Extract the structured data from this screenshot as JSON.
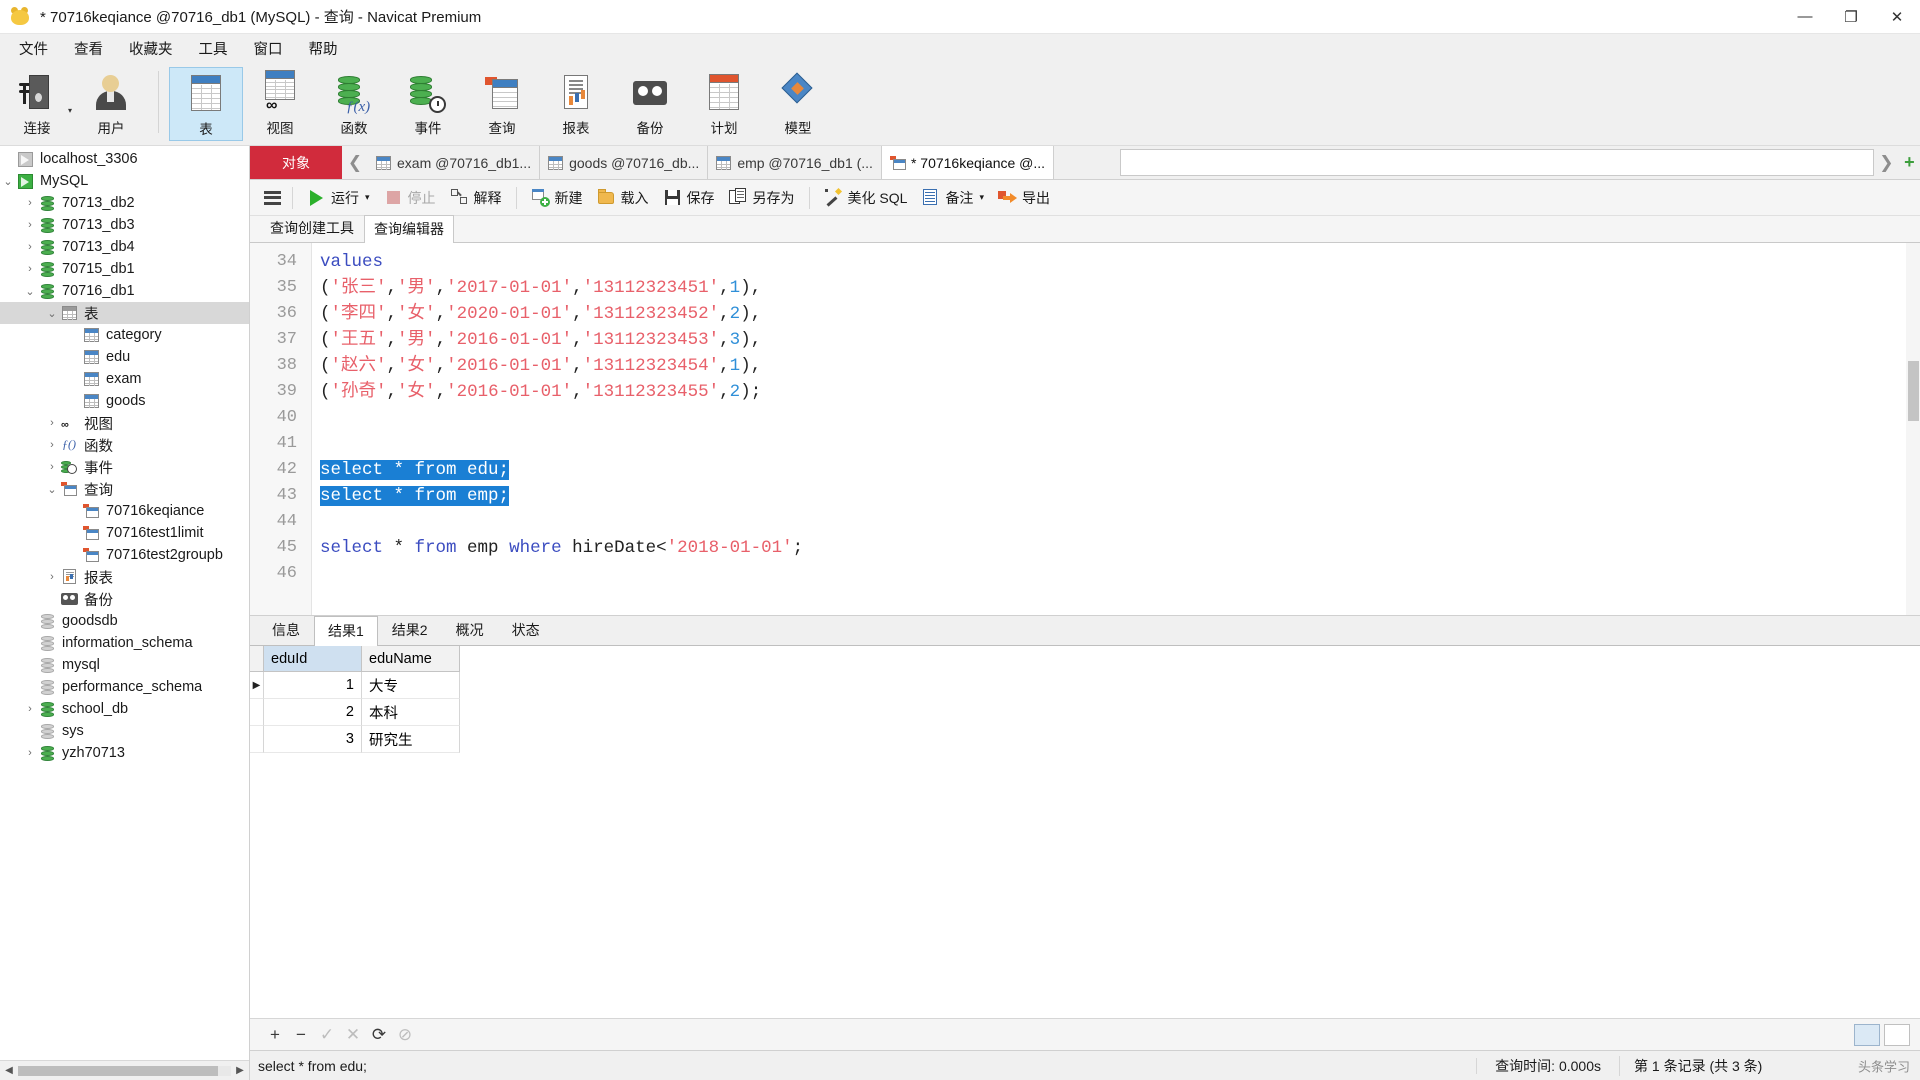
{
  "window": {
    "title": "* 70716keqiance @70716_db1 (MySQL) - 查询 - Navicat Premium",
    "minimize": "—",
    "maximize": "❐",
    "close": "✕"
  },
  "menubar": [
    "文件",
    "查看",
    "收藏夹",
    "工具",
    "窗口",
    "帮助"
  ],
  "ribbon": [
    {
      "label": "连接",
      "icon": "connection-icon",
      "caret": "▾"
    },
    {
      "label": "用户",
      "icon": "user-icon",
      "caret": ""
    },
    {
      "label": "表",
      "icon": "table-icon",
      "caret": "",
      "selected": true
    },
    {
      "label": "视图",
      "icon": "view-icon",
      "caret": ""
    },
    {
      "label": "函数",
      "icon": "function-icon",
      "caret": ""
    },
    {
      "label": "事件",
      "icon": "event-icon",
      "caret": ""
    },
    {
      "label": "查询",
      "icon": "query-icon",
      "caret": ""
    },
    {
      "label": "报表",
      "icon": "report-icon",
      "caret": ""
    },
    {
      "label": "备份",
      "icon": "backup-icon",
      "caret": ""
    },
    {
      "label": "计划",
      "icon": "schedule-icon",
      "caret": ""
    },
    {
      "label": "模型",
      "icon": "model-icon",
      "caret": ""
    }
  ],
  "sidebar": {
    "nodes": [
      {
        "label": "localhost_3306",
        "indent": 1,
        "twisty": "",
        "icon": "connection-off-icon"
      },
      {
        "label": "MySQL",
        "indent": 1,
        "twisty": "⌄",
        "icon": "connection-on-icon"
      },
      {
        "label": "70713_db2",
        "indent": 2,
        "twisty": "›",
        "icon": "database-icon"
      },
      {
        "label": "70713_db3",
        "indent": 2,
        "twisty": "›",
        "icon": "database-icon"
      },
      {
        "label": "70713_db4",
        "indent": 2,
        "twisty": "›",
        "icon": "database-icon"
      },
      {
        "label": "70715_db1",
        "indent": 2,
        "twisty": "›",
        "icon": "database-icon"
      },
      {
        "label": "70716_db1",
        "indent": 2,
        "twisty": "⌄",
        "icon": "database-icon"
      },
      {
        "label": "表",
        "indent": 3,
        "twisty": "⌄",
        "icon": "table-folder-icon",
        "selected": true
      },
      {
        "label": "category",
        "indent": 4,
        "twisty": "",
        "icon": "table-icon"
      },
      {
        "label": "edu",
        "indent": 4,
        "twisty": "",
        "icon": "table-icon"
      },
      {
        "label": "exam",
        "indent": 4,
        "twisty": "",
        "icon": "table-icon"
      },
      {
        "label": "goods",
        "indent": 4,
        "twisty": "",
        "icon": "table-icon"
      },
      {
        "label": "视图",
        "indent": 3,
        "twisty": "›",
        "icon": "view-icon"
      },
      {
        "label": "函数",
        "indent": 3,
        "twisty": "›",
        "icon": "function-icon"
      },
      {
        "label": "事件",
        "indent": 3,
        "twisty": "›",
        "icon": "event-icon"
      },
      {
        "label": "查询",
        "indent": 3,
        "twisty": "⌄",
        "icon": "query-icon"
      },
      {
        "label": "70716keqiance",
        "indent": 4,
        "twisty": "",
        "icon": "query-icon"
      },
      {
        "label": "70716test1limit",
        "indent": 4,
        "twisty": "",
        "icon": "query-icon"
      },
      {
        "label": "70716test2groupb",
        "indent": 4,
        "twisty": "",
        "icon": "query-icon"
      },
      {
        "label": "报表",
        "indent": 3,
        "twisty": "›",
        "icon": "report-icon"
      },
      {
        "label": "备份",
        "indent": 3,
        "twisty": "",
        "icon": "backup-icon"
      },
      {
        "label": "goodsdb",
        "indent": 2,
        "twisty": "",
        "icon": "database-grey-icon"
      },
      {
        "label": "information_schema",
        "indent": 2,
        "twisty": "",
        "icon": "database-grey-icon"
      },
      {
        "label": "mysql",
        "indent": 2,
        "twisty": "",
        "icon": "database-grey-icon"
      },
      {
        "label": "performance_schema",
        "indent": 2,
        "twisty": "",
        "icon": "database-grey-icon"
      },
      {
        "label": "school_db",
        "indent": 2,
        "twisty": "›",
        "icon": "database-icon"
      },
      {
        "label": "sys",
        "indent": 2,
        "twisty": "",
        "icon": "database-grey-icon"
      },
      {
        "label": "yzh70713",
        "indent": 2,
        "twisty": "›",
        "icon": "database-icon"
      }
    ]
  },
  "tabstrip": {
    "object_tab": "对象",
    "nav_left": "❮",
    "documents": [
      {
        "label": "exam @70716_db1...",
        "icon": "table-icon",
        "active": false
      },
      {
        "label": "goods @70716_db...",
        "icon": "table-icon",
        "active": false
      },
      {
        "label": "emp @70716_db1 (...",
        "icon": "table-icon",
        "active": false
      },
      {
        "label": "* 70716keqiance @...",
        "icon": "query-icon",
        "active": true
      }
    ],
    "nav_right": "❯",
    "add": "+"
  },
  "query_toolbar": {
    "menu_icon": "hamburger-icon",
    "buttons": [
      {
        "label": "运行",
        "icon": "run-icon",
        "disabled": false,
        "caret": "▾"
      },
      {
        "label": "停止",
        "icon": "stop-icon",
        "disabled": true,
        "caret": ""
      },
      {
        "label": "解释",
        "icon": "explain-icon",
        "disabled": false,
        "caret": ""
      },
      {
        "label": "新建",
        "icon": "new-icon",
        "disabled": false,
        "caret": ""
      },
      {
        "label": "载入",
        "icon": "load-icon",
        "disabled": false,
        "caret": ""
      },
      {
        "label": "保存",
        "icon": "save-icon",
        "disabled": false,
        "caret": ""
      },
      {
        "label": "另存为",
        "icon": "save-as-icon",
        "disabled": false,
        "caret": ""
      },
      {
        "label": "美化 SQL",
        "icon": "beautify-icon",
        "disabled": false,
        "caret": ""
      },
      {
        "label": "备注",
        "icon": "comment-icon",
        "disabled": false,
        "caret": "▾"
      },
      {
        "label": "导出",
        "icon": "export-icon",
        "disabled": false,
        "caret": ""
      }
    ]
  },
  "editor_tabs": [
    {
      "label": "查询创建工具",
      "active": false
    },
    {
      "label": "查询编辑器",
      "active": true
    }
  ],
  "editor": {
    "lines": [
      {
        "no": "34",
        "tokens": [
          {
            "t": "values",
            "c": "kw"
          }
        ]
      },
      {
        "no": "35",
        "tokens": [
          {
            "t": "(",
            "c": "punc"
          },
          {
            "t": "'张三'",
            "c": "str"
          },
          {
            "t": ",",
            "c": "punc"
          },
          {
            "t": "'男'",
            "c": "str"
          },
          {
            "t": ",",
            "c": "punc"
          },
          {
            "t": "'2017-01-01'",
            "c": "str"
          },
          {
            "t": ",",
            "c": "punc"
          },
          {
            "t": "'13112323451'",
            "c": "str"
          },
          {
            "t": ",",
            "c": "punc"
          },
          {
            "t": "1",
            "c": "num"
          },
          {
            "t": "),",
            "c": "punc"
          }
        ]
      },
      {
        "no": "36",
        "tokens": [
          {
            "t": "(",
            "c": "punc"
          },
          {
            "t": "'李四'",
            "c": "str"
          },
          {
            "t": ",",
            "c": "punc"
          },
          {
            "t": "'女'",
            "c": "str"
          },
          {
            "t": ",",
            "c": "punc"
          },
          {
            "t": "'2020-01-01'",
            "c": "str"
          },
          {
            "t": ",",
            "c": "punc"
          },
          {
            "t": "'13112323452'",
            "c": "str"
          },
          {
            "t": ",",
            "c": "punc"
          },
          {
            "t": "2",
            "c": "num"
          },
          {
            "t": "),",
            "c": "punc"
          }
        ]
      },
      {
        "no": "37",
        "tokens": [
          {
            "t": "(",
            "c": "punc"
          },
          {
            "t": "'王五'",
            "c": "str"
          },
          {
            "t": ",",
            "c": "punc"
          },
          {
            "t": "'男'",
            "c": "str"
          },
          {
            "t": ",",
            "c": "punc"
          },
          {
            "t": "'2016-01-01'",
            "c": "str"
          },
          {
            "t": ",",
            "c": "punc"
          },
          {
            "t": "'13112323453'",
            "c": "str"
          },
          {
            "t": ",",
            "c": "punc"
          },
          {
            "t": "3",
            "c": "num"
          },
          {
            "t": "),",
            "c": "punc"
          }
        ]
      },
      {
        "no": "38",
        "tokens": [
          {
            "t": "(",
            "c": "punc"
          },
          {
            "t": "'赵六'",
            "c": "str"
          },
          {
            "t": ",",
            "c": "punc"
          },
          {
            "t": "'女'",
            "c": "str"
          },
          {
            "t": ",",
            "c": "punc"
          },
          {
            "t": "'2016-01-01'",
            "c": "str"
          },
          {
            "t": ",",
            "c": "punc"
          },
          {
            "t": "'13112323454'",
            "c": "str"
          },
          {
            "t": ",",
            "c": "punc"
          },
          {
            "t": "1",
            "c": "num"
          },
          {
            "t": "),",
            "c": "punc"
          }
        ]
      },
      {
        "no": "39",
        "tokens": [
          {
            "t": "(",
            "c": "punc"
          },
          {
            "t": "'孙奇'",
            "c": "str"
          },
          {
            "t": ",",
            "c": "punc"
          },
          {
            "t": "'女'",
            "c": "str"
          },
          {
            "t": ",",
            "c": "punc"
          },
          {
            "t": "'2016-01-01'",
            "c": "str"
          },
          {
            "t": ",",
            "c": "punc"
          },
          {
            "t": "'13112323455'",
            "c": "str"
          },
          {
            "t": ",",
            "c": "punc"
          },
          {
            "t": "2",
            "c": "num"
          },
          {
            "t": ");",
            "c": "punc"
          }
        ]
      },
      {
        "no": "40",
        "tokens": []
      },
      {
        "no": "41",
        "tokens": []
      },
      {
        "no": "42",
        "selected": true,
        "tokens": [
          {
            "t": "select",
            "c": "kw"
          },
          {
            "t": " * ",
            "c": "punc"
          },
          {
            "t": "from",
            "c": "kw"
          },
          {
            "t": " edu;",
            "c": "pl"
          }
        ]
      },
      {
        "no": "43",
        "selected": true,
        "tokens": [
          {
            "t": "select",
            "c": "kw"
          },
          {
            "t": " * ",
            "c": "punc"
          },
          {
            "t": "from",
            "c": "kw"
          },
          {
            "t": " emp;",
            "c": "pl"
          }
        ]
      },
      {
        "no": "44",
        "tokens": []
      },
      {
        "no": "45",
        "tokens": [
          {
            "t": "select",
            "c": "kw"
          },
          {
            "t": " * ",
            "c": "punc"
          },
          {
            "t": "from",
            "c": "kw"
          },
          {
            "t": " emp ",
            "c": "pl"
          },
          {
            "t": "where",
            "c": "kw"
          },
          {
            "t": " hireDate<",
            "c": "pl"
          },
          {
            "t": "'2018-01-01'",
            "c": "str"
          },
          {
            "t": ";",
            "c": "punc"
          }
        ]
      },
      {
        "no": "46",
        "tokens": []
      }
    ]
  },
  "result_tabs": [
    {
      "label": "信息",
      "active": false
    },
    {
      "label": "结果1",
      "active": true
    },
    {
      "label": "结果2",
      "active": false
    },
    {
      "label": "概况",
      "active": false
    },
    {
      "label": "状态",
      "active": false
    }
  ],
  "result_grid": {
    "columns": [
      "eduId",
      "eduName"
    ],
    "rows": [
      {
        "marker": "▶",
        "cells": [
          "1",
          "大专"
        ]
      },
      {
        "marker": "",
        "cells": [
          "2",
          "本科"
        ]
      },
      {
        "marker": "",
        "cells": [
          "3",
          "研究生"
        ]
      }
    ]
  },
  "grid_toolbar": {
    "add": "+",
    "remove": "−",
    "check": "✓",
    "cancel": "✕",
    "refresh": "⟳",
    "stop": "⊘",
    "grid_view": "grid-view-icon",
    "form_view": "form-view-icon"
  },
  "statusbar": {
    "sql": "select * from edu;",
    "time_label": "查询时间: 0.000s",
    "record_info": "第 1 条记录 (共 3 条)",
    "watermark": "头条学习"
  }
}
